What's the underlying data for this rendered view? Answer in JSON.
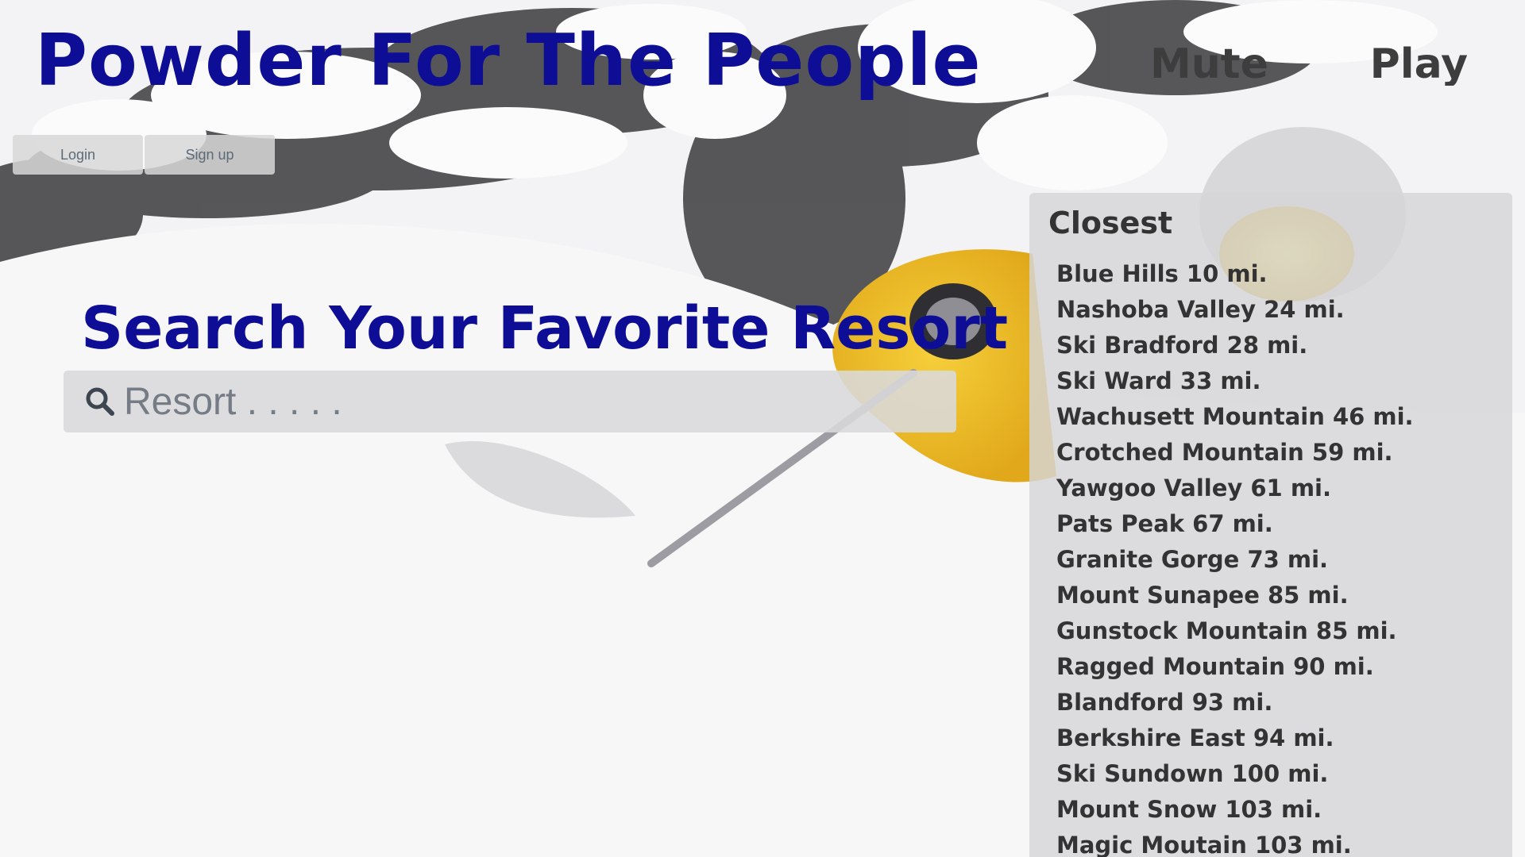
{
  "header": {
    "title": "Powder For The People",
    "mute_label": "Mute",
    "play_label": "Play"
  },
  "auth": {
    "login_label": "Login",
    "signup_label": "Sign up"
  },
  "search": {
    "heading": "Search Your Favorite Resort",
    "placeholder": "Resort . . . . ."
  },
  "closest": {
    "title": "Closest",
    "items": [
      "Blue Hills 10 mi.",
      "Nashoba Valley 24 mi.",
      "Ski Bradford 28 mi.",
      "Ski Ward 33 mi.",
      "Wachusett Mountain 46 mi.",
      "Crotched Mountain 59 mi.",
      "Yawgoo Valley 61 mi.",
      "Pats Peak 67 mi.",
      "Granite Gorge 73 mi.",
      "Mount Sunapee 85 mi.",
      "Gunstock Mountain 85 mi.",
      "Ragged Mountain 90 mi.",
      "Blandford 93 mi.",
      "Berkshire East 94 mi.",
      "Ski Sundown 100 mi.",
      "Mount Snow 103 mi.",
      "Magic Moutain 103 mi."
    ]
  },
  "colors": {
    "title_blue": "#0d0d96",
    "panel_text": "#333333",
    "jacket_yellow": "#f2c02a"
  }
}
